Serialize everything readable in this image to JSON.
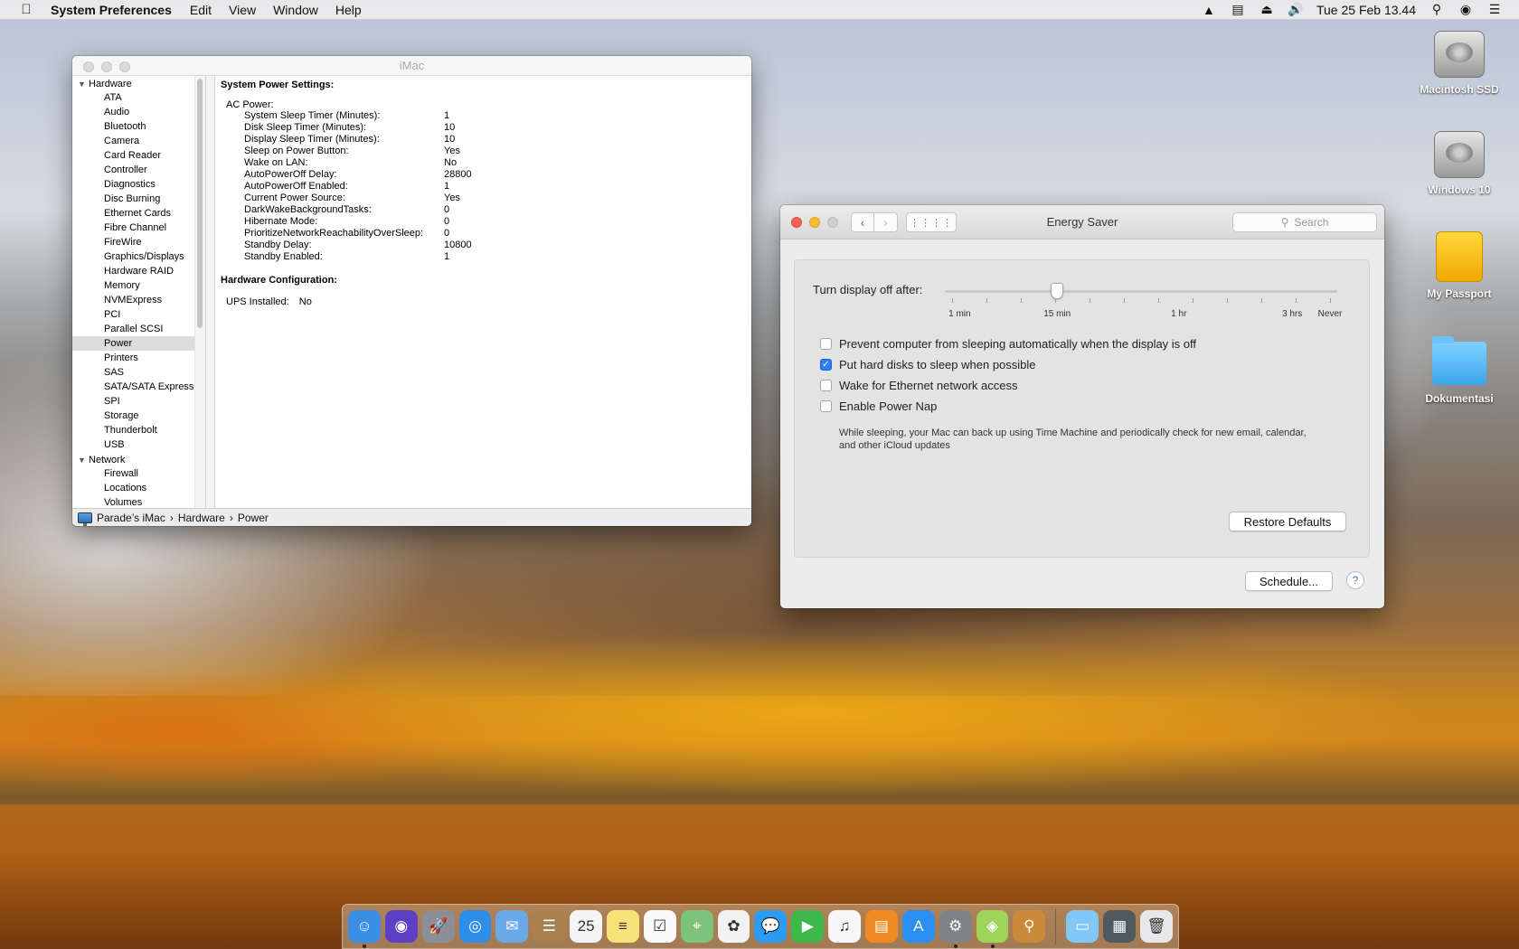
{
  "menubar": {
    "apple_icon": "apple-icon",
    "app_name": "System Preferences",
    "menus": [
      "Edit",
      "View",
      "Window",
      "Help"
    ],
    "clock": "Tue 25 Feb  13.44"
  },
  "desktop": {
    "icons": [
      {
        "label": "Macintosh SSD",
        "icon": "hard-drive-icon"
      },
      {
        "label": "Windows 10",
        "icon": "hard-drive-icon"
      },
      {
        "label": "My Passport",
        "icon": "external-drive-icon"
      },
      {
        "label": "Dokumentasi",
        "icon": "folder-icon"
      }
    ]
  },
  "sysinfo": {
    "title": "iMac",
    "sidebar": {
      "hardware_group": "Hardware",
      "hardware_items": [
        "ATA",
        "Audio",
        "Bluetooth",
        "Camera",
        "Card Reader",
        "Controller",
        "Diagnostics",
        "Disc Burning",
        "Ethernet Cards",
        "Fibre Channel",
        "FireWire",
        "Graphics/Displays",
        "Hardware RAID",
        "Memory",
        "NVMExpress",
        "PCI",
        "Parallel SCSI",
        "Power",
        "Printers",
        "SAS",
        "SATA/SATA Express",
        "SPI",
        "Storage",
        "Thunderbolt",
        "USB"
      ],
      "selected": "Power",
      "network_group": "Network",
      "network_items": [
        "Firewall",
        "Locations",
        "Volumes"
      ]
    },
    "content": {
      "heading": "System Power Settings:",
      "ac_power_label": "AC Power:",
      "settings": [
        {
          "key": "System Sleep Timer (Minutes):",
          "value": "1"
        },
        {
          "key": "Disk Sleep Timer (Minutes):",
          "value": "10"
        },
        {
          "key": "Display Sleep Timer (Minutes):",
          "value": "10"
        },
        {
          "key": "Sleep on Power Button:",
          "value": "Yes"
        },
        {
          "key": "Wake on LAN:",
          "value": "No"
        },
        {
          "key": "AutoPowerOff Delay:",
          "value": "28800"
        },
        {
          "key": "AutoPowerOff Enabled:",
          "value": "1"
        },
        {
          "key": "Current Power Source:",
          "value": "Yes"
        },
        {
          "key": "DarkWakeBackgroundTasks:",
          "value": "0"
        },
        {
          "key": "Hibernate Mode:",
          "value": "0"
        },
        {
          "key": "PrioritizeNetworkReachabilityOverSleep:",
          "value": "0"
        },
        {
          "key": "Standby Delay:",
          "value": "10800"
        },
        {
          "key": "Standby Enabled:",
          "value": "1"
        }
      ],
      "hw_config_heading": "Hardware Configuration:",
      "ups_label": "UPS Installed:",
      "ups_value": "No"
    },
    "breadcrumb": {
      "computer": "Parade’s iMac",
      "section": "Hardware",
      "item": "Power",
      "separator": "›"
    }
  },
  "energy": {
    "title": "Energy Saver",
    "search_placeholder": "Search",
    "slider": {
      "label": "Turn display off after:",
      "value_minutes": 15,
      "tick_labels": [
        "1 min",
        "15 min",
        "1 hr",
        "3 hrs",
        "Never"
      ]
    },
    "checkboxes": [
      {
        "label": "Prevent computer from sleeping automatically when the display is off",
        "checked": false
      },
      {
        "label": "Put hard disks to sleep when possible",
        "checked": true
      },
      {
        "label": "Wake for Ethernet network access",
        "checked": false
      },
      {
        "label": "Enable Power Nap",
        "checked": false
      }
    ],
    "power_nap_description": "While sleeping, your Mac can back up using Time Machine and periodically check for new email, calendar, and other iCloud updates",
    "restore_defaults": "Restore Defaults",
    "schedule": "Schedule...",
    "help": "?"
  },
  "dock": {
    "apps": [
      {
        "name": "finder-icon",
        "color": "#3a8ee6",
        "glyph": "☺",
        "running": true
      },
      {
        "name": "siri-icon",
        "color": "#5b3fc4",
        "glyph": "◉",
        "running": false
      },
      {
        "name": "launchpad-icon",
        "color": "#8b8f98",
        "glyph": "🚀",
        "running": false
      },
      {
        "name": "safari-icon",
        "color": "#2c8ee8",
        "glyph": "◎",
        "running": false
      },
      {
        "name": "mail-icon",
        "color": "#6aa9e8",
        "glyph": "✉",
        "running": false
      },
      {
        "name": "contacts-icon",
        "color": "#a9804f",
        "glyph": "☰",
        "running": false
      },
      {
        "name": "calendar-icon",
        "color": "#f4f4f4",
        "glyph": "25",
        "running": false
      },
      {
        "name": "notes-icon",
        "color": "#f9e27a",
        "glyph": "≡",
        "running": false
      },
      {
        "name": "reminders-icon",
        "color": "#fafafa",
        "glyph": "☑",
        "running": false
      },
      {
        "name": "maps-icon",
        "color": "#7cc47a",
        "glyph": "⌖",
        "running": false
      },
      {
        "name": "photos-icon",
        "color": "#f2f2f2",
        "glyph": "✿",
        "running": false
      },
      {
        "name": "messages-icon",
        "color": "#2b9bf4",
        "glyph": "💬",
        "running": false
      },
      {
        "name": "facetime-icon",
        "color": "#3cb94a",
        "glyph": "▶",
        "running": false
      },
      {
        "name": "itunes-icon",
        "color": "#f7f7f7",
        "glyph": "♫",
        "running": false
      },
      {
        "name": "ibooks-icon",
        "color": "#f08a24",
        "glyph": "▤",
        "running": false
      },
      {
        "name": "app-store-icon",
        "color": "#2b8ef0",
        "glyph": "A",
        "running": false
      },
      {
        "name": "system-preferences-icon",
        "color": "#808488",
        "glyph": "⚙",
        "running": true
      },
      {
        "name": "cube-app-icon",
        "color": "#9fd45a",
        "glyph": "◈",
        "running": true
      },
      {
        "name": "usb-utility-icon",
        "color": "#c98a3a",
        "glyph": "⚲",
        "running": false
      }
    ],
    "right": [
      {
        "name": "downloads-folder-icon",
        "color": "#7fc8f8",
        "glyph": "▭"
      },
      {
        "name": "system-information-icon",
        "color": "#505860",
        "glyph": "▦"
      },
      {
        "name": "trash-icon",
        "color": "#e8e8ea",
        "glyph": "🗑"
      }
    ]
  }
}
